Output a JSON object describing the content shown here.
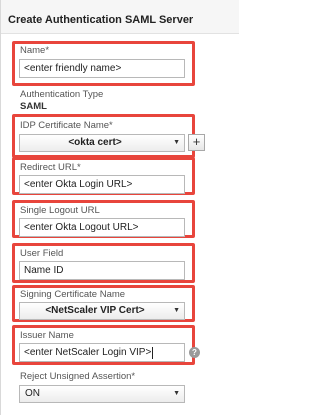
{
  "header": {
    "title": "Create Authentication SAML Server"
  },
  "name": {
    "label": "Name*",
    "value": "<enter friendly name>"
  },
  "auth_type": {
    "label": "Authentication Type",
    "value": "SAML"
  },
  "idp_cert": {
    "label": "IDP Certificate Name*",
    "value": "<okta cert>",
    "add_symbol": "+"
  },
  "redirect": {
    "label": "Redirect URL*",
    "value": "<enter Okta Login URL>"
  },
  "logout": {
    "label": "Single Logout URL",
    "value": "<enter Okta Logout URL>"
  },
  "user_field": {
    "label": "User Field",
    "value": "Name ID"
  },
  "signing": {
    "label": "Signing Certificate Name",
    "value": "<NetScaler VIP Cert>"
  },
  "issuer": {
    "label": "Issuer Name",
    "value": "<enter NetScaler Login VIP>",
    "help_symbol": "?"
  },
  "reject": {
    "label": "Reject Unsigned Assertion*",
    "value": "ON"
  },
  "icons": {
    "dropdown": "chevron-down-icon",
    "add": "plus-icon",
    "help": "help-icon"
  },
  "colors": {
    "highlight": "#e8453c",
    "header_bg": "#f6f6f6"
  }
}
